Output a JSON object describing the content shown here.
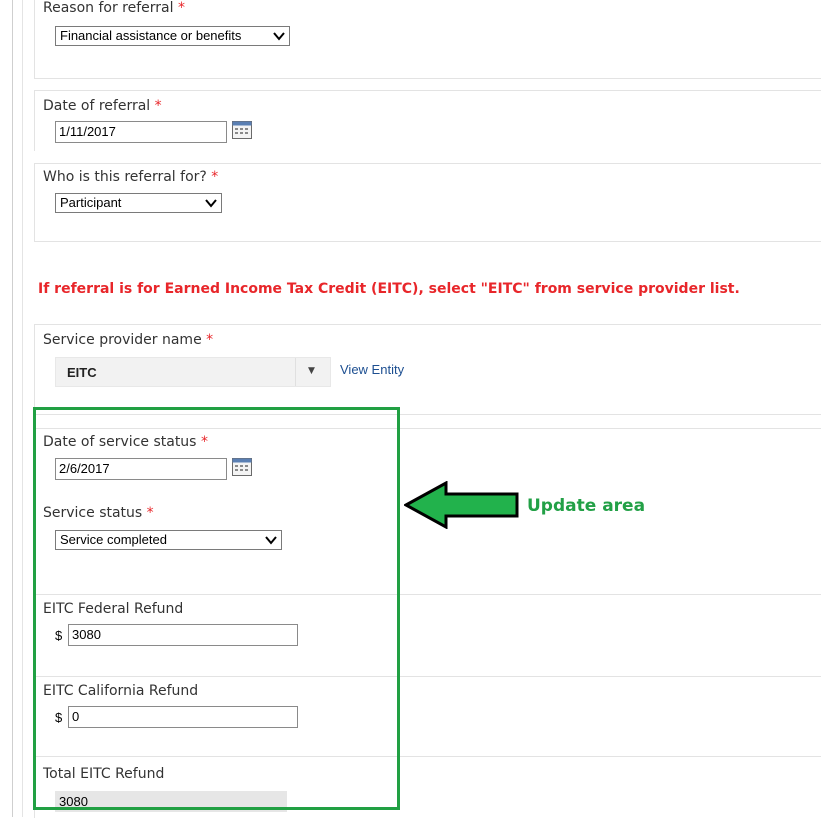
{
  "form": {
    "reason": {
      "label": "Reason for referral",
      "required": "*",
      "value": "Financial assistance or benefits"
    },
    "referral_date": {
      "label": "Date of referral",
      "required": "*",
      "value": "1/11/2017"
    },
    "referral_for": {
      "label": "Who is this referral for?",
      "required": "*",
      "value": "Participant"
    },
    "eitc_notice": "If referral is for Earned Income Tax Credit (EITC), select \"EITC\" from service provider list.",
    "provider": {
      "label": "Service provider name",
      "required": "*",
      "value": "EITC",
      "dropdown_glyph": "▼",
      "view_link": "View Entity"
    },
    "status_date": {
      "label": "Date of service status",
      "required": "*",
      "value": "2/6/2017"
    },
    "service_status": {
      "label": "Service status",
      "required": "*",
      "value": "Service completed"
    },
    "federal_refund": {
      "label": "EITC Federal Refund",
      "currency": "$",
      "value": "3080"
    },
    "california_refund": {
      "label": "EITC California Refund",
      "currency": "$",
      "value": "0"
    },
    "total_refund": {
      "label": "Total EITC Refund",
      "value": "3080"
    }
  },
  "annotation": {
    "label": "Update area",
    "color": "#21a043"
  },
  "icons": {
    "calendar": "calendar-icon",
    "dropdown": "chevron-down-icon",
    "arrow": "arrow-left-icon"
  },
  "colors": {
    "required": "#e8262a",
    "link": "#1d4f91",
    "highlight": "#21a043"
  }
}
